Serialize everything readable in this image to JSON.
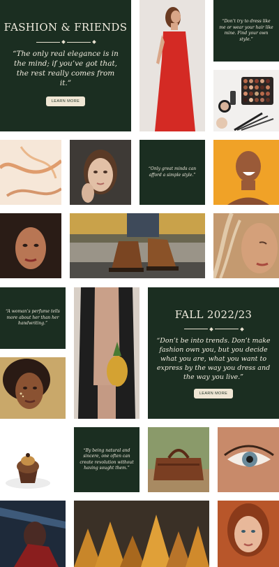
{
  "brand": {
    "title": "FASHION & FRIENDS",
    "quote": "“The only real elegance is in the mind; if you’ve got that, the rest really comes from it.”",
    "button": "LEARN MORE"
  },
  "quotes": {
    "dress_hair": "“Don’t try to dress like me or wear your hair like mine. Find your own style.”",
    "great_minds": "“Only great minds can afford a simple style.”",
    "perfume": "“A woman’s perfume tells more about her than her handwriting.”",
    "natural": "“By being natural and sincere, one often can create revolution without having sought them.”"
  },
  "fall": {
    "title": "FALL 2022/23",
    "quote": "“Don’t be into trends. Don’t make fashion own you, but you decide what you are, what you want to express by the way you dress and the way you live.”",
    "button": "LEARN MORE"
  },
  "colors": {
    "dark_green": "#1b2e21",
    "cream": "#efe6d4",
    "accent_red": "#d42a24"
  }
}
